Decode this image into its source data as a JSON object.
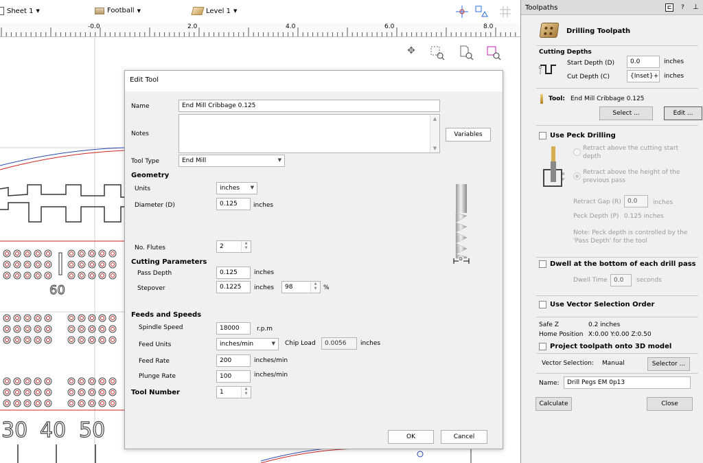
{
  "toolbar": {
    "sheet": "Sheet 1",
    "material": "Football",
    "level": "Level 1"
  },
  "ruler": {
    "labels": [
      "-0.0",
      "2.0",
      "4.0",
      "6.0",
      "8.0"
    ]
  },
  "canvas": {
    "numbers": [
      "60",
      "30",
      "40",
      "50"
    ]
  },
  "dialog": {
    "title": "Edit Tool",
    "name_label": "Name",
    "name_value": "End Mill Cribbage 0.125",
    "notes_label": "Notes",
    "variables_button": "Variables",
    "tool_type_label": "Tool Type",
    "tool_type_value": "End Mill",
    "geometry_header": "Geometry",
    "units_label": "Units",
    "units_value": "inches",
    "diameter_label": "Diameter (D)",
    "diameter_value": "0.125",
    "diameter_unit": "inches",
    "flutes_label": "No. Flutes",
    "flutes_value": "2",
    "cutting_header": "Cutting Parameters",
    "pass_depth_label": "Pass Depth",
    "pass_depth_value": "0.125",
    "pass_depth_unit": "inches",
    "stepover_label": "Stepover",
    "stepover_value": "0.1225",
    "stepover_unit": "inches",
    "stepover_pct": "98",
    "pct_symbol": "%",
    "feeds_header": "Feeds and Speeds",
    "spindle_label": "Spindle Speed",
    "spindle_value": "18000",
    "spindle_unit": "r.p.m",
    "feed_units_label": "Feed Units",
    "feed_units_value": "inches/min",
    "chip_load_label": "Chip Load",
    "chip_load_value": "0.0056",
    "chip_load_unit": "inches",
    "feed_rate_label": "Feed Rate",
    "feed_rate_value": "200",
    "feed_rate_unit": "inches/min",
    "plunge_rate_label": "Plunge Rate",
    "plunge_rate_value": "100",
    "plunge_rate_unit": "inches/min",
    "tool_number_label": "Tool Number",
    "tool_number_value": "1",
    "ok_button": "OK",
    "cancel_button": "Cancel",
    "diagram_d_label": "D"
  },
  "panel": {
    "header": "Toolpaths",
    "help_glyph": "?",
    "pin_glyph": "⊥",
    "title": "Drilling Toolpath",
    "cutting_depths_header": "Cutting Depths",
    "start_depth_label": "Start Depth (D)",
    "start_depth_value": "0.0",
    "start_depth_unit": "inches",
    "cut_depth_label": "Cut Depth (C)",
    "cut_depth_value": "{Inset}+",
    "cut_depth_unit": "inches",
    "tool_label": "Tool:",
    "tool_name": "End Mill Cribbage 0.125",
    "select_button": "Select ...",
    "edit_button": "Edit ...",
    "peck_label": "Use Peck Drilling",
    "retract_cut_line1": "Retract above the cutting start",
    "retract_cut_line2": "depth",
    "retract_height_line1": "Retract above the height of the",
    "retract_height_line2": "previous pass",
    "retract_gap_label": "Retract Gap (R)",
    "retract_gap_value": "0.0",
    "retract_gap_unit": "inches",
    "peck_depth_label": "Peck Depth (P)",
    "peck_depth_value": "0.125 inches",
    "note_line1": "Note: Peck depth is controlled by the",
    "note_line2": "'Pass Depth' for the tool",
    "dwell_label": "Dwell at the bottom of each drill pass",
    "dwell_time_label": "Dwell Time",
    "dwell_time_value": "0.0",
    "dwell_time_unit": "seconds",
    "vector_order_label": "Use Vector Selection Order",
    "safe_z_label": "Safe Z",
    "safe_z_value": "0.2 inches",
    "home_label": "Home Position",
    "home_value": "X:0.00 Y:0.00 Z:0.50",
    "project_label": "Project toolpath onto 3D model",
    "vector_sel_label": "Vector Selection:",
    "vector_sel_value": "Manual",
    "selector_button": "Selector ...",
    "name_label": "Name:",
    "name_value": "Drill Pegs EM 0p13",
    "calculate_button": "Calculate",
    "close_button": "Close"
  }
}
